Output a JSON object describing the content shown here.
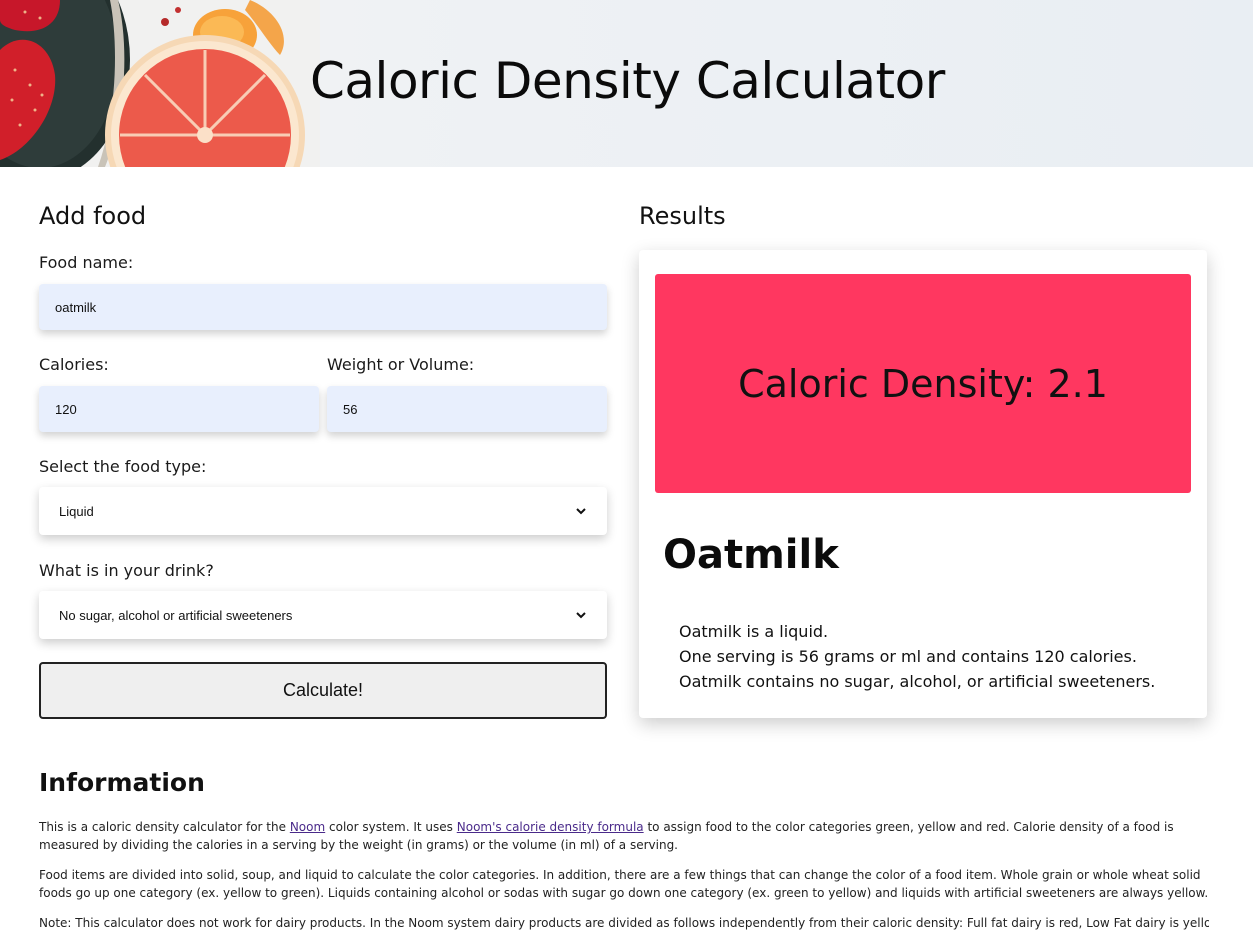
{
  "header": {
    "title": "Caloric Density Calculator"
  },
  "form": {
    "section_title": "Add food",
    "food_name_label": "Food name:",
    "food_name_value": "oatmilk",
    "calories_label": "Calories:",
    "calories_value": "120",
    "weight_label": "Weight or Volume:",
    "weight_value": "56",
    "food_type_label": "Select the food type:",
    "food_type_value": "Liquid",
    "drink_label": "What is in your drink?",
    "drink_value": "No sugar, alcohol or artificial sweeteners",
    "calculate_label": "Calculate!"
  },
  "results": {
    "section_title": "Results",
    "density_text": "Caloric Density: 2.1",
    "density_color": "#ff3760",
    "food_heading": "Oatmilk",
    "lines": [
      "Oatmilk is a liquid.",
      "One serving is 56 grams or ml and contains 120 calories.",
      "Oatmilk contains no sugar, alcohol, or artificial sweeteners."
    ]
  },
  "information": {
    "title": "Information",
    "p1_a": "This is a caloric density calculator for the ",
    "p1_link1": "Noom",
    "p1_b": " color system. It uses ",
    "p1_link2": "Noom's calorie density formula",
    "p1_c": " to assign food to the color categories green, yellow and red. Calorie density of a food is measured by dividing the calories in a serving by the weight (in grams) or the volume (in ml) of a serving.",
    "p2": "Food items are divided into solid, soup, and liquid to calculate the color categories. In addition, there are a few things that can change the color of a food item. Whole grain or whole wheat solid foods go up one category (ex. yellow to green). Liquids containing alcohol or sodas with sugar go down one category (ex. green to yellow) and liquids with artificial sweeteners are always yellow.",
    "p3": "Note: This calculator does not work for dairy products. In the Noom system dairy products are divided as follows independently from their caloric density: Full fat dairy is red, Low Fat dairy is yellow"
  }
}
